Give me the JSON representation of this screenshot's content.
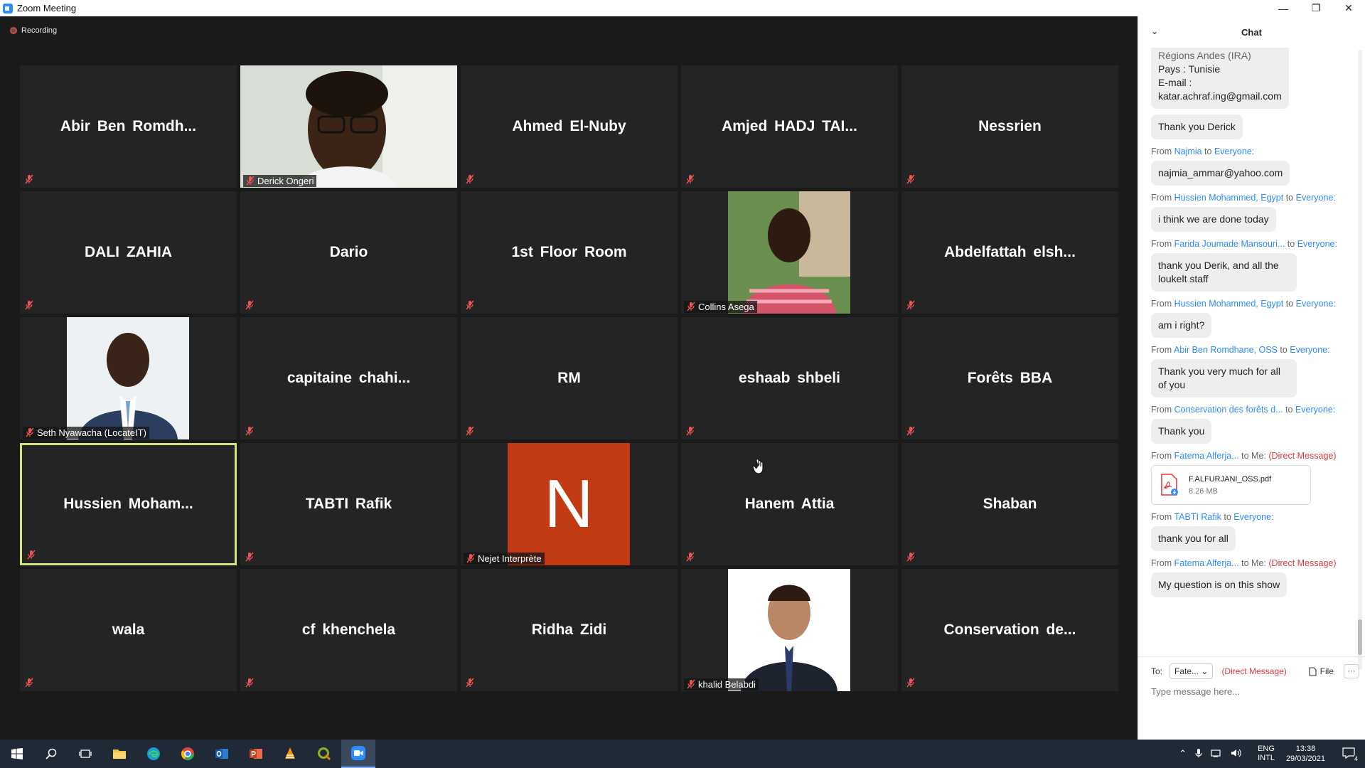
{
  "window": {
    "title": "Zoom Meeting",
    "minimize": "—",
    "restore": "❐",
    "close": "✕"
  },
  "recording": "Recording",
  "participants": [
    {
      "name": "Abir  Ben  Romdh...",
      "type": "name"
    },
    {
      "name": "Derick Ongeri",
      "type": "photo"
    },
    {
      "name": "Ahmed El-Nuby",
      "type": "name"
    },
    {
      "name": "Amjed  HADJ  TAI...",
      "type": "name"
    },
    {
      "name": "Nessrien",
      "type": "name"
    },
    {
      "name": "DALI ZAHIA",
      "type": "name"
    },
    {
      "name": "Dario",
      "type": "name"
    },
    {
      "name": "1st Floor Room",
      "type": "name"
    },
    {
      "name": "Collins Asega",
      "type": "photo"
    },
    {
      "name": "Abdelfattah  elsh...",
      "type": "name"
    },
    {
      "name": "Seth Nyawacha (LocateIT)",
      "type": "photo"
    },
    {
      "name": "capitaine  chahi...",
      "type": "name"
    },
    {
      "name": "RM",
      "type": "name"
    },
    {
      "name": "eshaab shbeli",
      "type": "name"
    },
    {
      "name": "Forêts BBA",
      "type": "name"
    },
    {
      "name": "Hussien  Moham...",
      "type": "name",
      "active": true
    },
    {
      "name": "TABTI Rafik",
      "type": "name"
    },
    {
      "name": "Nejet Interprète",
      "type": "avatar",
      "initial": "N"
    },
    {
      "name": "Hanem Attia",
      "type": "name"
    },
    {
      "name": "Shaban",
      "type": "name"
    },
    {
      "name": "wala",
      "type": "name"
    },
    {
      "name": "cf khenchela",
      "type": "name"
    },
    {
      "name": "Ridha Zidi",
      "type": "name"
    },
    {
      "name": "khalid Belabdi",
      "type": "photo"
    },
    {
      "name": "Conservation  de...",
      "type": "name"
    }
  ],
  "chat": {
    "title": "Chat",
    "top_partial": [
      "Régions Andes (IRA)",
      "Pays : Tunisie",
      "E-mail :",
      "katar.achraf.ing@gmail.com"
    ],
    "thank_derick": "Thank you Derick",
    "messages": [
      {
        "from_label": "From",
        "from": "Najmia",
        "to_label": "to",
        "to": "Everyone:",
        "text": "najmia_ammar@yahoo.com"
      },
      {
        "from_label": "From",
        "from": "Hussien Mohammed, Egypt",
        "to_label": "to",
        "to": "Everyone:",
        "text": "i think we are done today"
      },
      {
        "from_label": "From",
        "from": "Farida Joumade Mansouri...",
        "to_label": "to",
        "to": "Everyone:",
        "text": "thank you Derik, and all the loukelt staff"
      },
      {
        "from_label": "From",
        "from": "Hussien Mohammed, Egypt",
        "to_label": "to",
        "to": "Everyone:",
        "text": "am i right?"
      },
      {
        "from_label": "From",
        "from": "Abir Ben Romdhane, OSS",
        "to_label": "to",
        "to": "Everyone:",
        "text": "Thank you very much for all of you"
      },
      {
        "from_label": "From",
        "from": "Conservation des forêts d...",
        "to_label": "to",
        "to": "Everyone:",
        "text": "Thank you"
      }
    ],
    "dm1": {
      "from_label": "From",
      "from": "Fatema Alferja...",
      "to_label": "to Me:",
      "dm": "(Direct Message)"
    },
    "file": {
      "name": "F.ALFURJANI_OSS.pdf",
      "size": "8.26 MB"
    },
    "msg_tabti": {
      "from_label": "From",
      "from": "TABTI Rafik",
      "to_label": "to",
      "to": "Everyone:",
      "text": "thank you for all"
    },
    "dm2": {
      "from_label": "From",
      "from": "Fatema Alferja...",
      "to_label": "to Me:",
      "dm": "(Direct Message)",
      "text": "My question is on this show"
    },
    "to_label": "To:",
    "to_value": "Fate...",
    "to_dm": "(Direct Message)",
    "file_btn": "File",
    "more_btn": "···",
    "input_placeholder": "Type message here..."
  },
  "taskbar": {
    "lang1": "ENG",
    "lang2": "INTL",
    "time": "13:38",
    "date": "29/03/2021",
    "notif_count": "4"
  }
}
